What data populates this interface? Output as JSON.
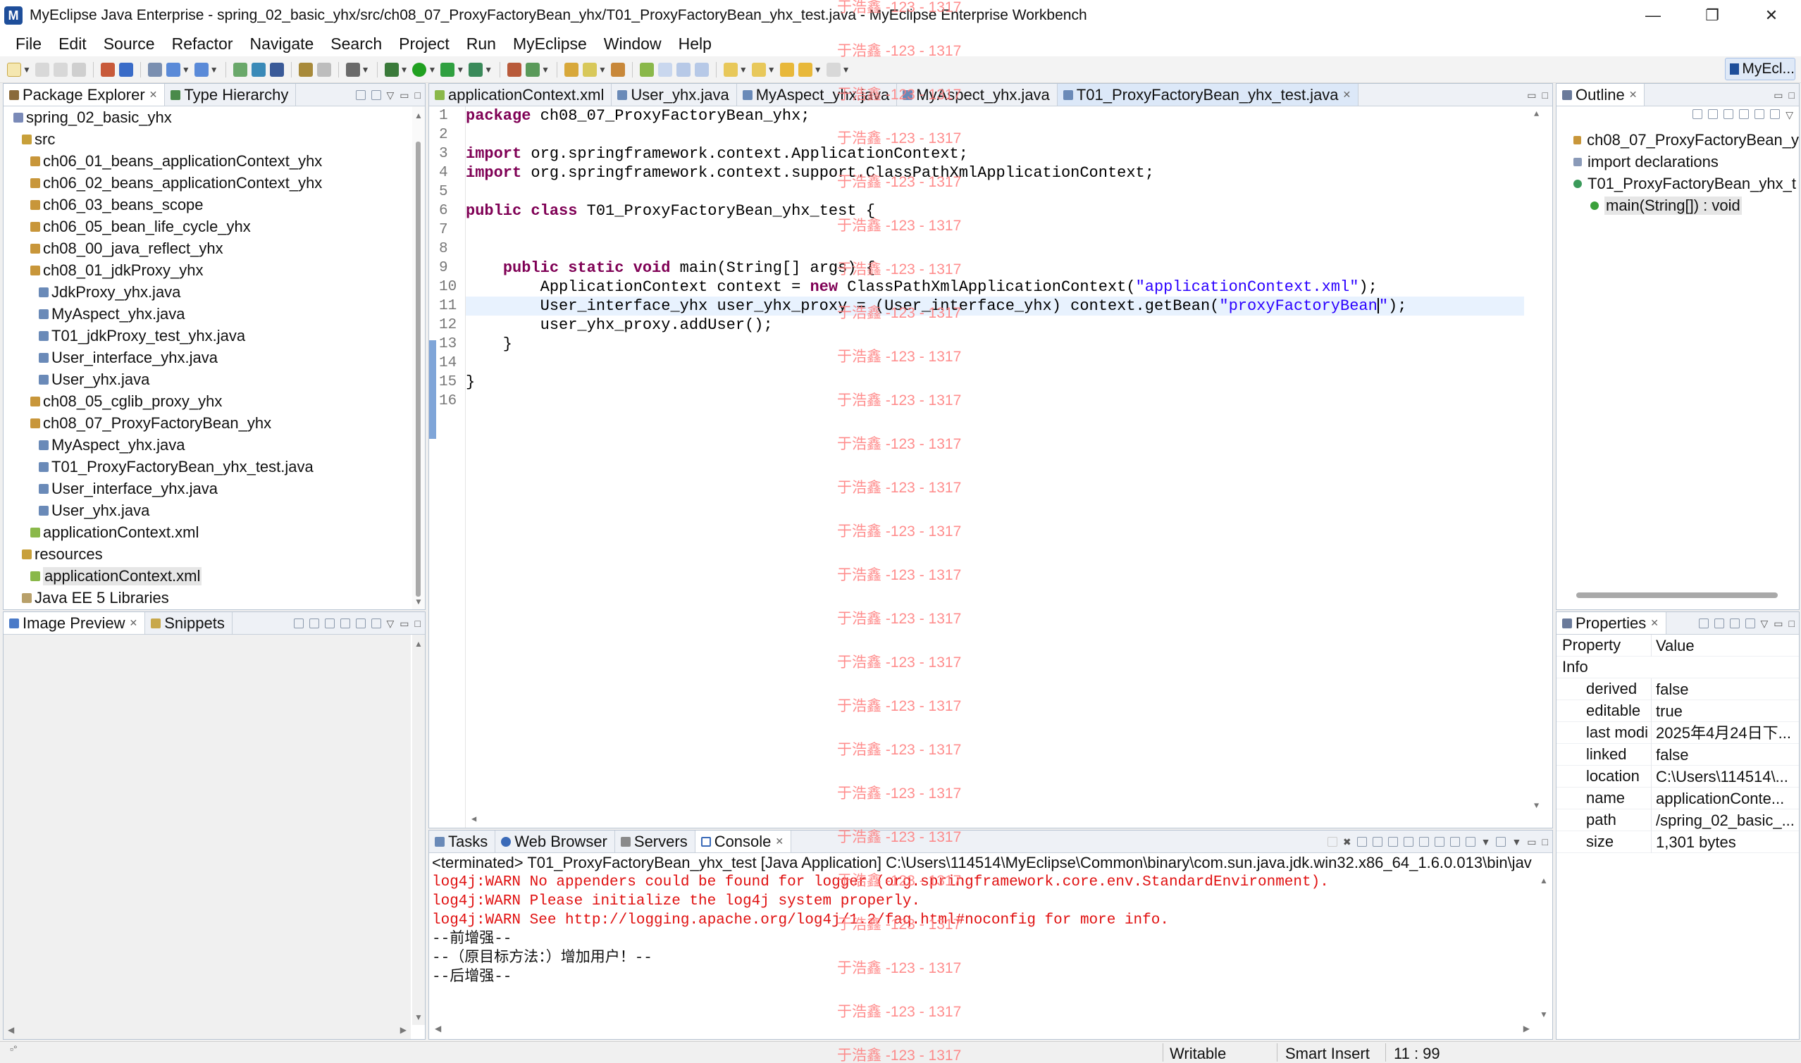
{
  "window": {
    "title": "MyEclipse Java Enterprise - spring_02_basic_yhx/src/ch08_07_ProxyFactoryBean_yhx/T01_ProxyFactoryBean_yhx_test.java - MyEclipse Enterprise Workbench",
    "minimize": "—",
    "maximize": "❐",
    "close": "✕"
  },
  "menu": [
    "File",
    "Edit",
    "Source",
    "Refactor",
    "Navigate",
    "Search",
    "Project",
    "Run",
    "MyEclipse",
    "Window",
    "Help"
  ],
  "perspective": "MyEcl...",
  "package_explorer": {
    "tabs": [
      "Package Explorer",
      "Type Hierarchy"
    ],
    "items": [
      {
        "label": "spring_02_basic_yhx",
        "indent": 0,
        "icon": "project-icon"
      },
      {
        "label": "src",
        "indent": 1,
        "icon": "source-folder-icon"
      },
      {
        "label": "ch06_01_beans_applicationContext_yhx",
        "indent": 2,
        "icon": "package-icon"
      },
      {
        "label": "ch06_02_beans_applicationContext_yhx",
        "indent": 2,
        "icon": "package-icon"
      },
      {
        "label": "ch06_03_beans_scope",
        "indent": 2,
        "icon": "package-icon"
      },
      {
        "label": "ch06_05_bean_life_cycle_yhx",
        "indent": 2,
        "icon": "package-icon"
      },
      {
        "label": "ch08_00_java_reflect_yhx",
        "indent": 2,
        "icon": "package-icon"
      },
      {
        "label": "ch08_01_jdkProxy_yhx",
        "indent": 2,
        "icon": "package-icon"
      },
      {
        "label": "JdkProxy_yhx.java",
        "indent": 3,
        "icon": "java-file-icon"
      },
      {
        "label": "MyAspect_yhx.java",
        "indent": 3,
        "icon": "java-file-icon"
      },
      {
        "label": "T01_jdkProxy_test_yhx.java",
        "indent": 3,
        "icon": "java-file-icon"
      },
      {
        "label": "User_interface_yhx.java",
        "indent": 3,
        "icon": "java-file-icon"
      },
      {
        "label": "User_yhx.java",
        "indent": 3,
        "icon": "java-file-icon"
      },
      {
        "label": "ch08_05_cglib_proxy_yhx",
        "indent": 2,
        "icon": "package-icon"
      },
      {
        "label": "ch08_07_ProxyFactoryBean_yhx",
        "indent": 2,
        "icon": "package-icon"
      },
      {
        "label": "MyAspect_yhx.java",
        "indent": 3,
        "icon": "java-file-icon"
      },
      {
        "label": "T01_ProxyFactoryBean_yhx_test.java",
        "indent": 3,
        "icon": "java-file-icon"
      },
      {
        "label": "User_interface_yhx.java",
        "indent": 3,
        "icon": "java-file-icon"
      },
      {
        "label": "User_yhx.java",
        "indent": 3,
        "icon": "java-file-icon"
      },
      {
        "label": "applicationContext.xml",
        "indent": 2,
        "icon": "xml-file-icon"
      },
      {
        "label": "resources",
        "indent": 1,
        "icon": "source-folder-icon"
      },
      {
        "label": "applicationContext.xml",
        "indent": 2,
        "icon": "xml-file-icon",
        "selected": true
      },
      {
        "label": "Java EE 5 Libraries",
        "indent": 1,
        "icon": "library-icon"
      }
    ]
  },
  "image_preview": {
    "tabs": [
      "Image Preview",
      "Snippets"
    ]
  },
  "editor": {
    "tabs": [
      {
        "label": "applicationContext.xml"
      },
      {
        "label": "User_yhx.java"
      },
      {
        "label": "MyAspect_yhx.java"
      },
      {
        "label": "MyAspect_yhx.java"
      },
      {
        "label": "T01_ProxyFactoryBean_yhx_test.java",
        "active": true
      }
    ],
    "line_numbers": [
      "1",
      "2",
      "3",
      "4",
      "5",
      "6",
      "7",
      "8",
      "9",
      "10",
      "11",
      "12",
      "13",
      "14",
      "15",
      "16"
    ]
  },
  "code": {
    "l1_kw": "package",
    "l1_rest": " ch08_07_ProxyFactoryBean_yhx;",
    "l3_kw": "import",
    "l3_rest": " org.springframework.context.ApplicationContext;",
    "l4_kw": "import",
    "l4_rest": " org.springframework.context.support.ClassPathXmlApplicationContext;",
    "l6_kw1": "public",
    "l6_kw2": "class",
    "l6_rest": " T01_ProxyFactoryBean_yhx_test {",
    "l9_indent": "    ",
    "l9_kw1": "public",
    "l9_kw2": "static",
    "l9_kw3": "void",
    "l9_rest": " main(String[] args) {",
    "l10_a": "        ApplicationContext context = ",
    "l10_kw": "new",
    "l10_b": " ClassPathXmlApplicationContext(",
    "l10_str": "\"applicationContext.xml\"",
    "l10_c": ");",
    "l11_a": "        User_interface_yhx user_yhx_proxy = (User_interface_yhx) context.getBean(",
    "l11_str": "\"proxyFactoryBean",
    "l11_str2": "\"",
    "l11_c": ");",
    "l12": "        user_yhx_proxy.addUser();",
    "l13": "    }",
    "l15": "}"
  },
  "console": {
    "tabs": [
      "Tasks",
      "Web Browser",
      "Servers",
      "Console"
    ],
    "header": "<terminated> T01_ProxyFactoryBean_yhx_test [Java Application] C:\\Users\\114514\\MyEclipse\\Common\\binary\\com.sun.java.jdk.win32.x86_64_1.6.0.013\\bin\\jav",
    "lines": [
      {
        "text": "log4j:WARN No appenders could be found for logger (org.springframework.core.env.StandardEnvironment).",
        "err": true
      },
      {
        "text": "log4j:WARN Please initialize the log4j system properly.",
        "err": true
      },
      {
        "text": "log4j:WARN See http://logging.apache.org/log4j/1.2/faq.html#noconfig for more info.",
        "err": true
      },
      {
        "text": "--前增强--",
        "err": false
      },
      {
        "text": "--（原目标方法：）增加用户！--",
        "err": false
      },
      {
        "text": "--后增强--",
        "err": false
      }
    ]
  },
  "outline": {
    "tab": "Outline",
    "items": [
      {
        "label": "ch08_07_ProxyFactoryBean_y",
        "indent": 0,
        "icon": "package-icon"
      },
      {
        "label": "import declarations",
        "indent": 0,
        "icon": "imports-icon"
      },
      {
        "label": "T01_ProxyFactoryBean_yhx_t",
        "indent": 0,
        "icon": "class-icon"
      },
      {
        "label": "main(String[]) : void",
        "indent": 1,
        "icon": "method-icon",
        "selected": true
      }
    ]
  },
  "properties": {
    "tab": "Properties",
    "col_property": "Property",
    "col_value": "Value",
    "group": "Info",
    "rows": [
      {
        "key": "derived",
        "value": "false"
      },
      {
        "key": "editable",
        "value": "true"
      },
      {
        "key": "last modi",
        "value": "2025年4月24日下..."
      },
      {
        "key": "linked",
        "value": "false"
      },
      {
        "key": "location",
        "value": "C:\\Users\\114514\\..."
      },
      {
        "key": "name",
        "value": "applicationConte..."
      },
      {
        "key": "path",
        "value": "/spring_02_basic_..."
      },
      {
        "key": "size",
        "value": "1,301  bytes"
      }
    ]
  },
  "status": {
    "writable": "Writable",
    "insert_mode": "Smart Insert",
    "position": "11 : 99"
  },
  "watermark": "于浩鑫 -123 - 1317",
  "colors": {
    "keyword": "#7f0055",
    "string": "#2a00ff",
    "console_error": "#e01010",
    "watermark": "#ff7a7a"
  }
}
